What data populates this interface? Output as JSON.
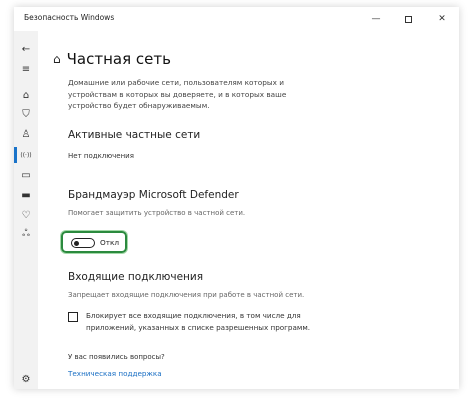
{
  "window": {
    "title": "Безопасность Windows",
    "minimize": "—",
    "close": "✕"
  },
  "sidebar": {
    "items": [
      {
        "icon": "back-arrow-icon",
        "glyph": "←"
      },
      {
        "icon": "menu-icon",
        "glyph": "≡"
      },
      {
        "icon": "home-icon",
        "glyph": "⌂"
      },
      {
        "icon": "shield-icon",
        "glyph": "⛉"
      },
      {
        "icon": "account-icon",
        "glyph": "♙"
      },
      {
        "icon": "network-icon",
        "glyph": "((·))"
      },
      {
        "icon": "app-browser-icon",
        "glyph": "▭"
      },
      {
        "icon": "device-security-icon",
        "glyph": "▬"
      },
      {
        "icon": "health-icon",
        "glyph": "♡"
      },
      {
        "icon": "family-icon",
        "glyph": "ஃ"
      },
      {
        "icon": "settings-icon",
        "glyph": "⚙"
      }
    ],
    "selected_index": 5
  },
  "page": {
    "title": "Частная сеть",
    "description": "Домашние или рабочие сети, пользователям которых и устройствам в которых вы доверяете, и в которых ваше устройство будет обнаруживаемым."
  },
  "active_networks": {
    "heading": "Активные частные сети",
    "value": "Нет подключения"
  },
  "firewall": {
    "heading": "Брандмауэр Microsoft Defender",
    "subtitle": "Помогает защитить устройство в частной сети.",
    "toggle_state": "off",
    "toggle_label": "Откл",
    "highlight_color": "#2b8a3e"
  },
  "incoming": {
    "heading": "Входящие подключения",
    "subtitle": "Запрещает входящие подключения при работе в частной сети.",
    "checkbox_checked": false,
    "checkbox_label": "Блокирует все входящие подключения, в том числе для приложений, указанных в списке разрешенных программ."
  },
  "help": {
    "heading": "У вас появились вопросы?",
    "link": "Техническая поддержка"
  },
  "colors": {
    "accent": "#1a73c9",
    "link": "#1a6fc4"
  }
}
